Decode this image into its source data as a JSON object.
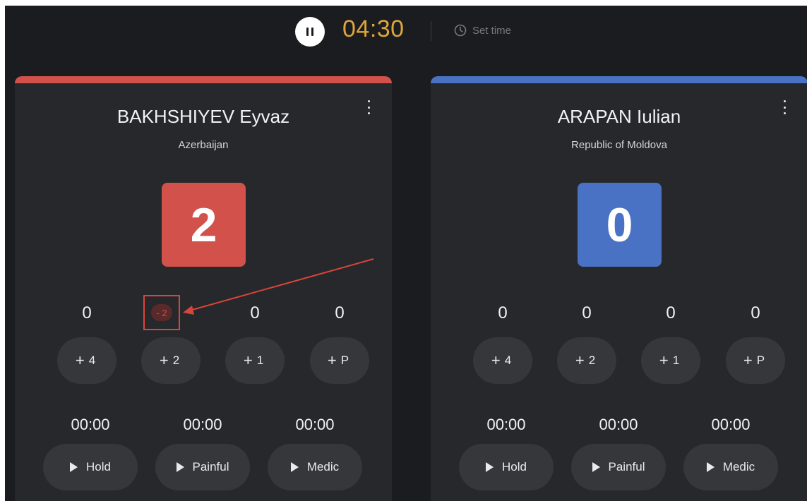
{
  "timer": {
    "time": "04:30",
    "set_time_label": "Set time"
  },
  "competitors": [
    {
      "name": "BAKHSHIYEV Eyvaz",
      "country": "Azerbaijan",
      "color": "#d2514b",
      "score": "2",
      "counters": [
        "0",
        "",
        "0",
        "0"
      ],
      "buttons": [
        {
          "sign": "+",
          "label": "4"
        },
        {
          "sign": "+",
          "label": "2"
        },
        {
          "sign": "+",
          "label": "1"
        },
        {
          "sign": "+",
          "label": "P"
        }
      ],
      "timers": [
        "00:00",
        "00:00",
        "00:00"
      ],
      "actions": [
        "Hold",
        "Painful",
        "Medic"
      ],
      "minus_label": "- 2"
    },
    {
      "name": "ARAPAN Iulian",
      "country": "Republic of Moldova",
      "color": "#4a72c4",
      "score": "0",
      "counters": [
        "0",
        "0",
        "0",
        "0"
      ],
      "buttons": [
        {
          "sign": "+",
          "label": "4"
        },
        {
          "sign": "+",
          "label": "2"
        },
        {
          "sign": "+",
          "label": "1"
        },
        {
          "sign": "+",
          "label": "P"
        }
      ],
      "timers": [
        "00:00",
        "00:00",
        "00:00"
      ],
      "actions": [
        "Hold",
        "Painful",
        "Medic"
      ]
    }
  ],
  "colors": {
    "background": "#1a1c1f",
    "card": "#26282b",
    "button": "#35373b",
    "clock": "#e0a53a",
    "annotation": "#d9453b"
  },
  "icons": [
    "pause-icon",
    "clock-icon",
    "more-vertical-icon",
    "play-icon"
  ]
}
